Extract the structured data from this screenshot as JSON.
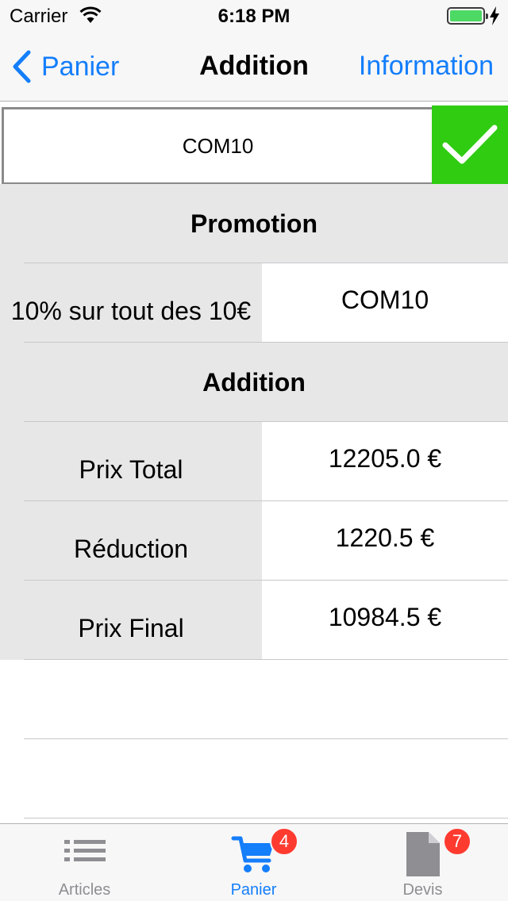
{
  "status_bar": {
    "carrier": "Carrier",
    "time": "6:18 PM",
    "battery_level": 1.0,
    "icons": [
      "wifi-icon",
      "battery-icon",
      "charging-bolt-icon"
    ]
  },
  "nav": {
    "back_label": "Panier",
    "title": "Addition",
    "right_label": "Information",
    "accent_color": "#147efb"
  },
  "promo_input": {
    "value": "COM10",
    "confirm_icon": "checkmark-icon",
    "confirm_color": "#2fcc12"
  },
  "promotion": {
    "header": "Promotion",
    "description": "10% sur tout des 10€",
    "code": "COM10"
  },
  "addition": {
    "header": "Addition",
    "rows": [
      {
        "label": "Prix Total",
        "value": "12205.0 €"
      },
      {
        "label": "Réduction",
        "value": "1220.5 €"
      },
      {
        "label": "Prix Final",
        "value": "10984.5 €"
      }
    ]
  },
  "tab_bar": {
    "tabs": [
      {
        "label": "Articles",
        "icon": "list-icon",
        "badge": ""
      },
      {
        "label": "Panier",
        "icon": "cart-icon",
        "badge": "4",
        "selected": true
      },
      {
        "label": "Devis",
        "icon": "document-icon",
        "badge": "7"
      }
    ],
    "badge_color": "#ff3b30"
  }
}
